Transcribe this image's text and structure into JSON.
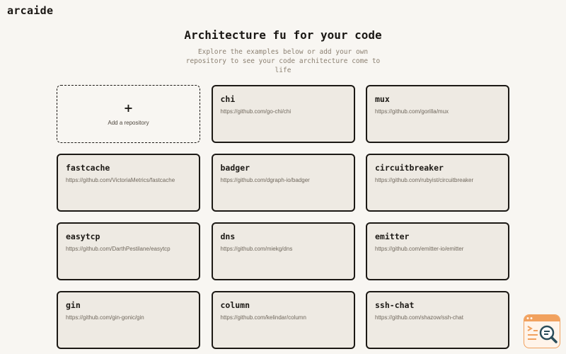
{
  "header": {
    "logo": "arcaide"
  },
  "hero": {
    "title": "Architecture fu for your code",
    "subtitle": "Explore the examples below or add your own repository to see your code architecture come to life"
  },
  "add_card": {
    "icon": "plus",
    "label": "Add a repository"
  },
  "repos": [
    {
      "name": "chi",
      "url": "https://github.com/go-chi/chi"
    },
    {
      "name": "mux",
      "url": "https://github.com/gorilla/mux"
    },
    {
      "name": "fastcache",
      "url": "https://github.com/VictoriaMetrics/fastcache"
    },
    {
      "name": "badger",
      "url": "https://github.com/dgraph-io/badger"
    },
    {
      "name": "circuitbreaker",
      "url": "https://github.com/rubyist/circuitbreaker"
    },
    {
      "name": "easytcp",
      "url": "https://github.com/DarthPestilane/easytcp"
    },
    {
      "name": "dns",
      "url": "https://github.com/miekg/dns"
    },
    {
      "name": "emitter",
      "url": "https://github.com/emitter-io/emitter"
    },
    {
      "name": "gin",
      "url": "https://github.com/gin-gonic/gin"
    },
    {
      "name": "column",
      "url": "https://github.com/kelindar/column"
    },
    {
      "name": "ssh-chat",
      "url": "https://github.com/shazow/ssh-chat"
    }
  ],
  "widget": {
    "icon": "search-document-icon"
  },
  "colors": {
    "background": "#f8f6f2",
    "card": "#eeeae3",
    "border": "#1c1915",
    "widget_accent": "#f1a15e"
  }
}
